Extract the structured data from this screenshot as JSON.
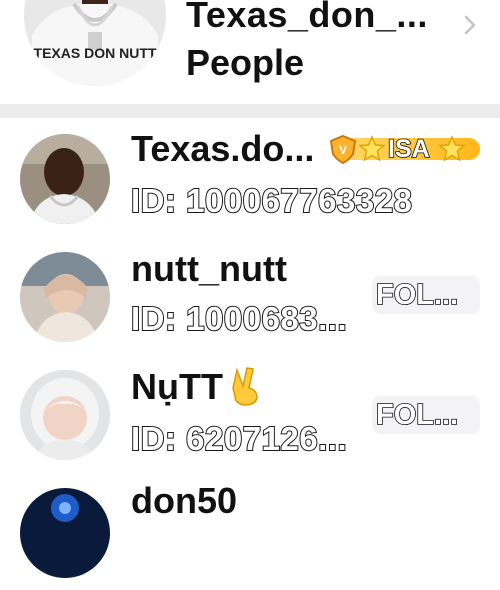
{
  "header": {
    "title": "Texas_don_...",
    "subtitle": "People",
    "avatar_shirt_text": "TEXAS DON NUTT"
  },
  "people": [
    {
      "name": "Texas.do...",
      "id": "ID: 100067763328",
      "badge": "ISA",
      "follow": ""
    },
    {
      "name": "nutt_nutt",
      "id": "ID: 1000683...",
      "badge": "",
      "follow": "FOL..."
    },
    {
      "name": "NụTT",
      "id": "ID: 6207126...",
      "badge": "",
      "follow": "FOL..."
    },
    {
      "name": "don50",
      "id": "",
      "badge": "",
      "follow": ""
    }
  ],
  "icons": {
    "chevron": "chevron-right-icon",
    "badge_shield": "shield-icon",
    "badge_star": "star-icon",
    "victory_hand": "victory-hand-emoji"
  },
  "colors": {
    "divider": "#ececec",
    "badge_gold": "#ffc53a",
    "chevron": "#c4c4c4",
    "follow_bg": "#f3f3f6"
  }
}
